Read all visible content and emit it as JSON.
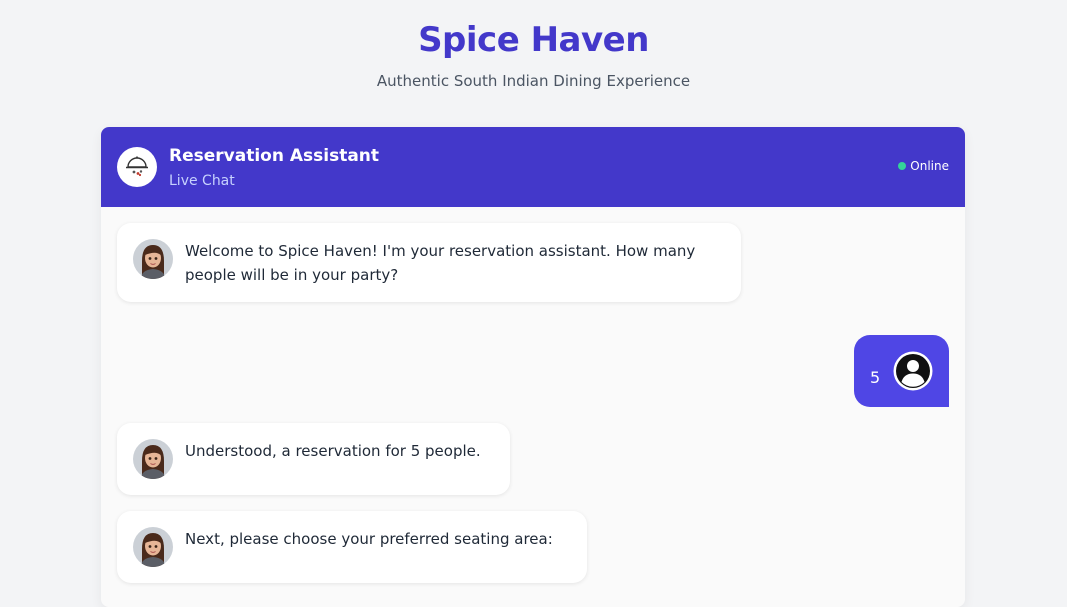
{
  "brand": {
    "title": "Spice Haven",
    "subtitle": "Authentic South Indian Dining Experience"
  },
  "chat": {
    "header": {
      "title": "Reservation Assistant",
      "subtitle": "Live Chat",
      "status": "Online",
      "status_color": "#34d399",
      "accent_color": "#4338ca"
    },
    "messages": [
      {
        "sender": "bot",
        "text": "Welcome to Spice Haven! I'm your reservation assistant. How many people will be in your party?"
      },
      {
        "sender": "user",
        "text": "5"
      },
      {
        "sender": "bot",
        "text": "Understood, a reservation for 5 people."
      },
      {
        "sender": "bot",
        "text": "Next, please choose your preferred seating area:"
      }
    ]
  }
}
